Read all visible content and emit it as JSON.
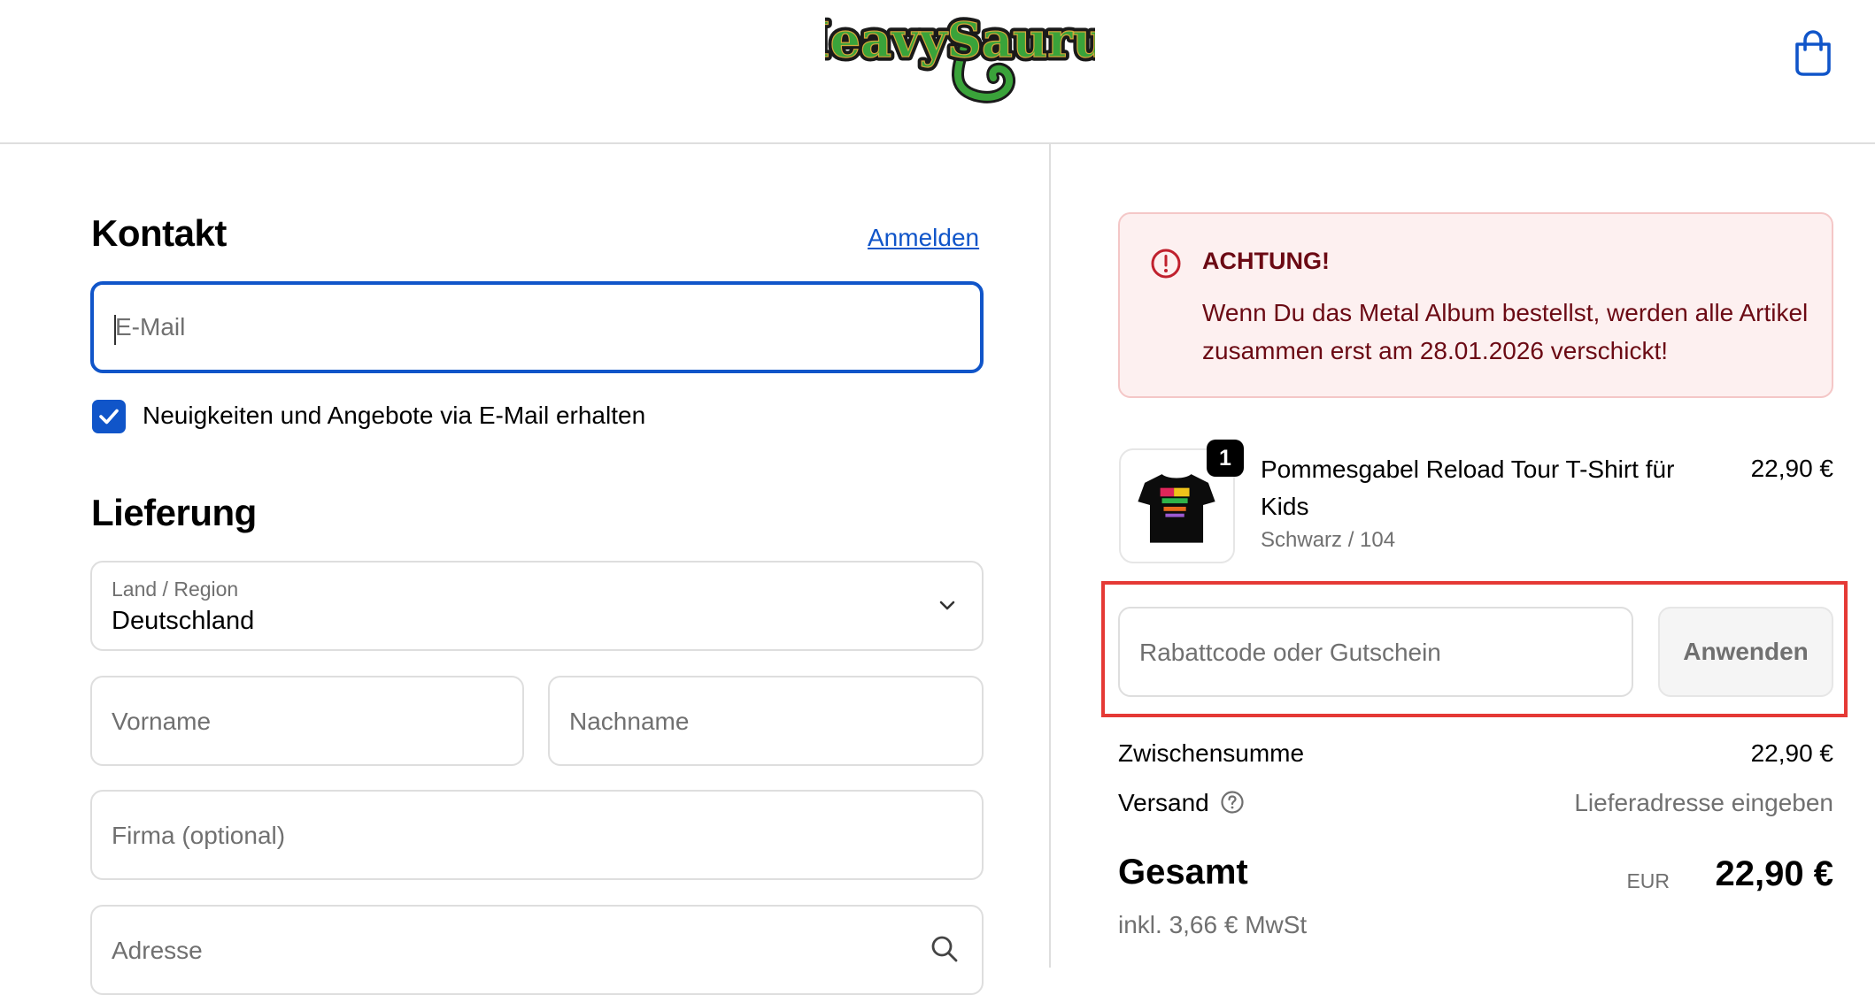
{
  "header": {
    "logo_text": "HeavySaurus",
    "logo_colors": {
      "fill": "#3aa33a",
      "outline": "#1a1a1a",
      "accent": "#d4a93a"
    },
    "cart_icon": "shopping-bag-icon"
  },
  "contact": {
    "heading": "Kontakt",
    "login_link": "Anmelden",
    "email_placeholder": "E-Mail",
    "newsletter_checked": true,
    "newsletter_label": "Neuigkeiten und Angebote via E-Mail erhalten"
  },
  "delivery": {
    "heading": "Lieferung",
    "country_label": "Land / Region",
    "country_value": "Deutschland",
    "first_name_placeholder": "Vorname",
    "last_name_placeholder": "Nachname",
    "company_placeholder": "Firma (optional)",
    "address_placeholder": "Adresse"
  },
  "notice": {
    "icon": "alert-circle-icon",
    "title": "ACHTUNG!",
    "text": "Wenn Du das Metal Album bestellst, werden alle Artikel zusammen erst am 28.01.2026 verschickt!"
  },
  "cart": {
    "items": [
      {
        "quantity": "1",
        "name": "Pommesgabel Reload Tour T-Shirt für Kids",
        "variant": "Schwarz / 104",
        "price": "22,90 €"
      }
    ]
  },
  "discount": {
    "placeholder": "Rabattcode oder Gutschein",
    "apply_label": "Anwenden"
  },
  "summary": {
    "subtotal_label": "Zwischensumme",
    "subtotal_value": "22,90 €",
    "shipping_label": "Versand",
    "shipping_value": "Lieferadresse eingeben",
    "total_label": "Gesamt",
    "currency": "EUR",
    "total_value": "22,90 €",
    "tax_note": "inkl. 3,66 € MwSt"
  },
  "colors": {
    "accent": "#1055c9",
    "notice_bg": "#fdf0f0",
    "notice_text": "#6b0a14",
    "highlight": "#e53935"
  }
}
